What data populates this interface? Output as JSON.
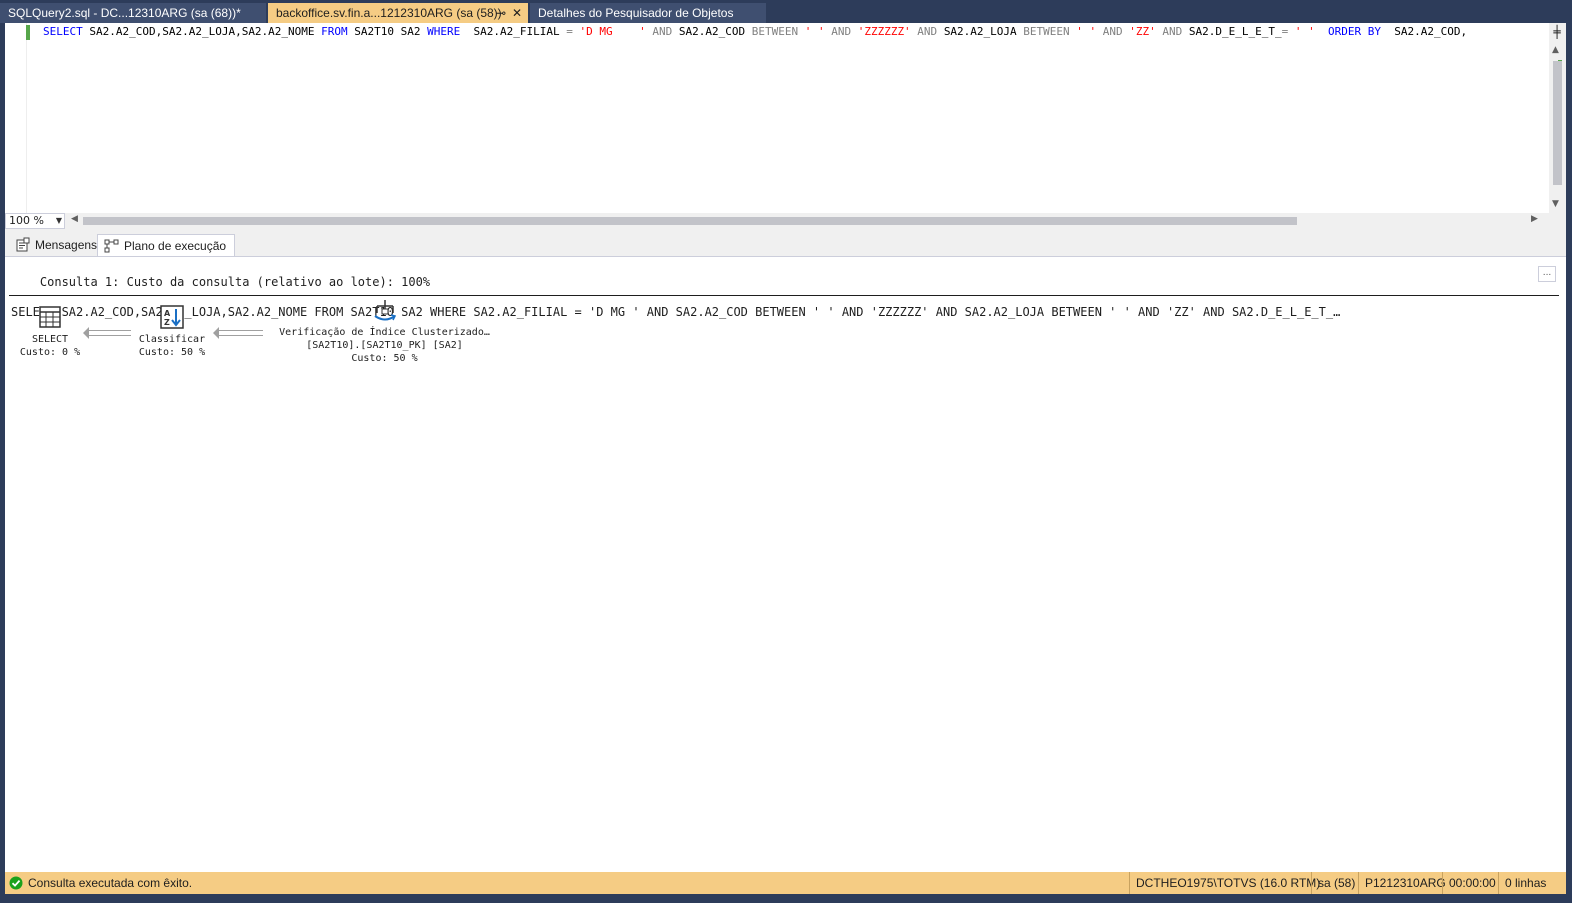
{
  "tabs": [
    {
      "label": "SQLQuery2.sql - DC...12310ARG (sa (68))*",
      "active": false
    },
    {
      "label": "backoffice.sv.fin.a...1212310ARG (sa (58))",
      "active": true
    },
    {
      "label": "Detalhes do Pesquisador de Objetos",
      "active": false
    }
  ],
  "tab_controls": {
    "pin": "⊸",
    "close": "✕"
  },
  "editor": {
    "sql": [
      {
        "t": "SELECT",
        "c": "kw"
      },
      {
        "t": " SA2.A2_COD,SA2.A2_LOJA,SA2.A2_NOME ",
        "c": "id"
      },
      {
        "t": "FROM",
        "c": "kw"
      },
      {
        "t": " SA2T10 SA2 ",
        "c": "id"
      },
      {
        "t": "WHERE",
        "c": "kw"
      },
      {
        "t": "  SA2.A2_FILIAL ",
        "c": "id"
      },
      {
        "t": "=",
        "c": "op"
      },
      {
        "t": " 'D MG    '",
        "c": "str"
      },
      {
        "t": " AND ",
        "c": "op"
      },
      {
        "t": "SA2.A2_COD ",
        "c": "id"
      },
      {
        "t": "BETWEEN",
        "c": "op"
      },
      {
        "t": " ' '",
        "c": "str"
      },
      {
        "t": " AND ",
        "c": "op"
      },
      {
        "t": "'ZZZZZZ'",
        "c": "str"
      },
      {
        "t": " AND ",
        "c": "op"
      },
      {
        "t": "SA2.A2_LOJA ",
        "c": "id"
      },
      {
        "t": "BETWEEN",
        "c": "op"
      },
      {
        "t": " ' '",
        "c": "str"
      },
      {
        "t": " AND ",
        "c": "op"
      },
      {
        "t": "'ZZ'",
        "c": "str"
      },
      {
        "t": " AND ",
        "c": "op"
      },
      {
        "t": "SA2.D_E_L_E_T_",
        "c": "id"
      },
      {
        "t": "=",
        "c": "op"
      },
      {
        "t": " ' '",
        "c": "str"
      },
      {
        "t": "  ",
        "c": "id"
      },
      {
        "t": "ORDER BY",
        "c": "kw"
      },
      {
        "t": "  SA2.A2_COD,",
        "c": "id"
      }
    ]
  },
  "zoom": "100 %",
  "result_tabs": [
    {
      "label": "Mensagens",
      "icon": "messages-icon"
    },
    {
      "label": "Plano de execução",
      "icon": "execution-plan-icon"
    }
  ],
  "plan": {
    "header": "Consulta 1: Custo da consulta (relativo ao lote): 100%",
    "sql": "SELECT SA2.A2_COD,SA2.A2_LOJA,SA2.A2_NOME FROM SA2T10 SA2 WHERE SA2.A2_FILIAL = 'D MG ' AND SA2.A2_COD BETWEEN ' ' AND 'ZZZZZZ' AND SA2.A2_LOJA BETWEEN ' ' AND 'ZZ' AND SA2.D_E_L_E_T_…",
    "more": "...",
    "nodes": [
      {
        "name": "SELECT",
        "cost": "Custo: 0 %",
        "icon": "select-operator-icon"
      },
      {
        "name": "Classificar",
        "cost": "Custo: 50 %",
        "icon": "sort-operator-icon"
      },
      {
        "name": "Verificação de Índice Clusterizado…",
        "object": "[SA2T10].[SA2T10_PK] [SA2]",
        "cost": "Custo: 50 %",
        "icon": "clustered-index-scan-icon"
      }
    ]
  },
  "status": {
    "message": "Consulta executada com êxito.",
    "server": "DCTHEO1975\\TOTVS (16.0 RTM)",
    "user": "sa (58)",
    "database": "P1212310ARG",
    "elapsed": "00:00:00",
    "rows": "0 linhas"
  },
  "colors": {
    "accent": "#f5cc84",
    "frame": "#2d3c5a",
    "keyword": "#0000ff",
    "string": "#ff0000",
    "success": "#1ba11b"
  }
}
